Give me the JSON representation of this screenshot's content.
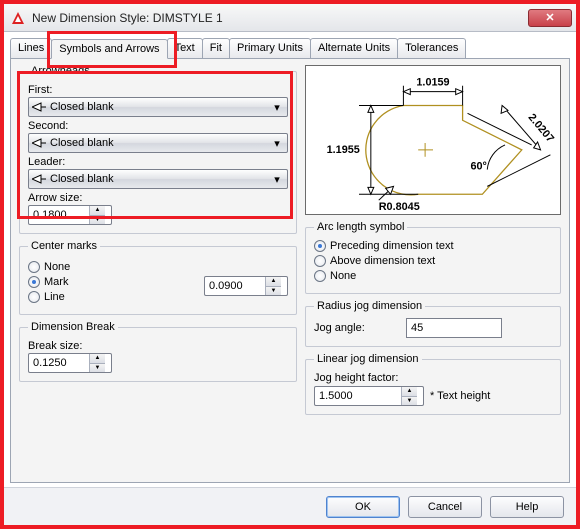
{
  "window": {
    "title": "New Dimension Style: DIMSTYLE 1"
  },
  "tabs": {
    "lines": "Lines",
    "symbols": "Symbols and Arrows",
    "text": "Text",
    "fit": "Fit",
    "primary": "Primary Units",
    "alternate": "Alternate Units",
    "tolerances": "Tolerances"
  },
  "arrowheads": {
    "legend": "Arrowheads",
    "first_label": "First:",
    "first_value": "Closed blank",
    "second_label": "Second:",
    "second_value": "Closed blank",
    "leader_label": "Leader:",
    "leader_value": "Closed blank",
    "size_label": "Arrow size:",
    "size_value": "0.1800"
  },
  "center_marks": {
    "legend": "Center marks",
    "none": "None",
    "mark": "Mark",
    "line": "Line",
    "value": "0.0900",
    "selected": "mark"
  },
  "dim_break": {
    "legend": "Dimension Break",
    "label": "Break size:",
    "value": "0.1250"
  },
  "arc_length": {
    "legend": "Arc length symbol",
    "preceding": "Preceding dimension text",
    "above": "Above dimension text",
    "none": "None",
    "selected": "preceding"
  },
  "radius_jog": {
    "legend": "Radius jog dimension",
    "label": "Jog angle:",
    "value": "45"
  },
  "linear_jog": {
    "legend": "Linear jog dimension",
    "label": "Jog height factor:",
    "value": "1.5000",
    "suffix": "* Text height"
  },
  "preview": {
    "dim_top": "1.0159",
    "dim_left": "1.1955",
    "dim_diag": "2.0207",
    "angle": "60°",
    "radius": "R0.8045"
  },
  "buttons": {
    "ok": "OK",
    "cancel": "Cancel",
    "help": "Help"
  }
}
